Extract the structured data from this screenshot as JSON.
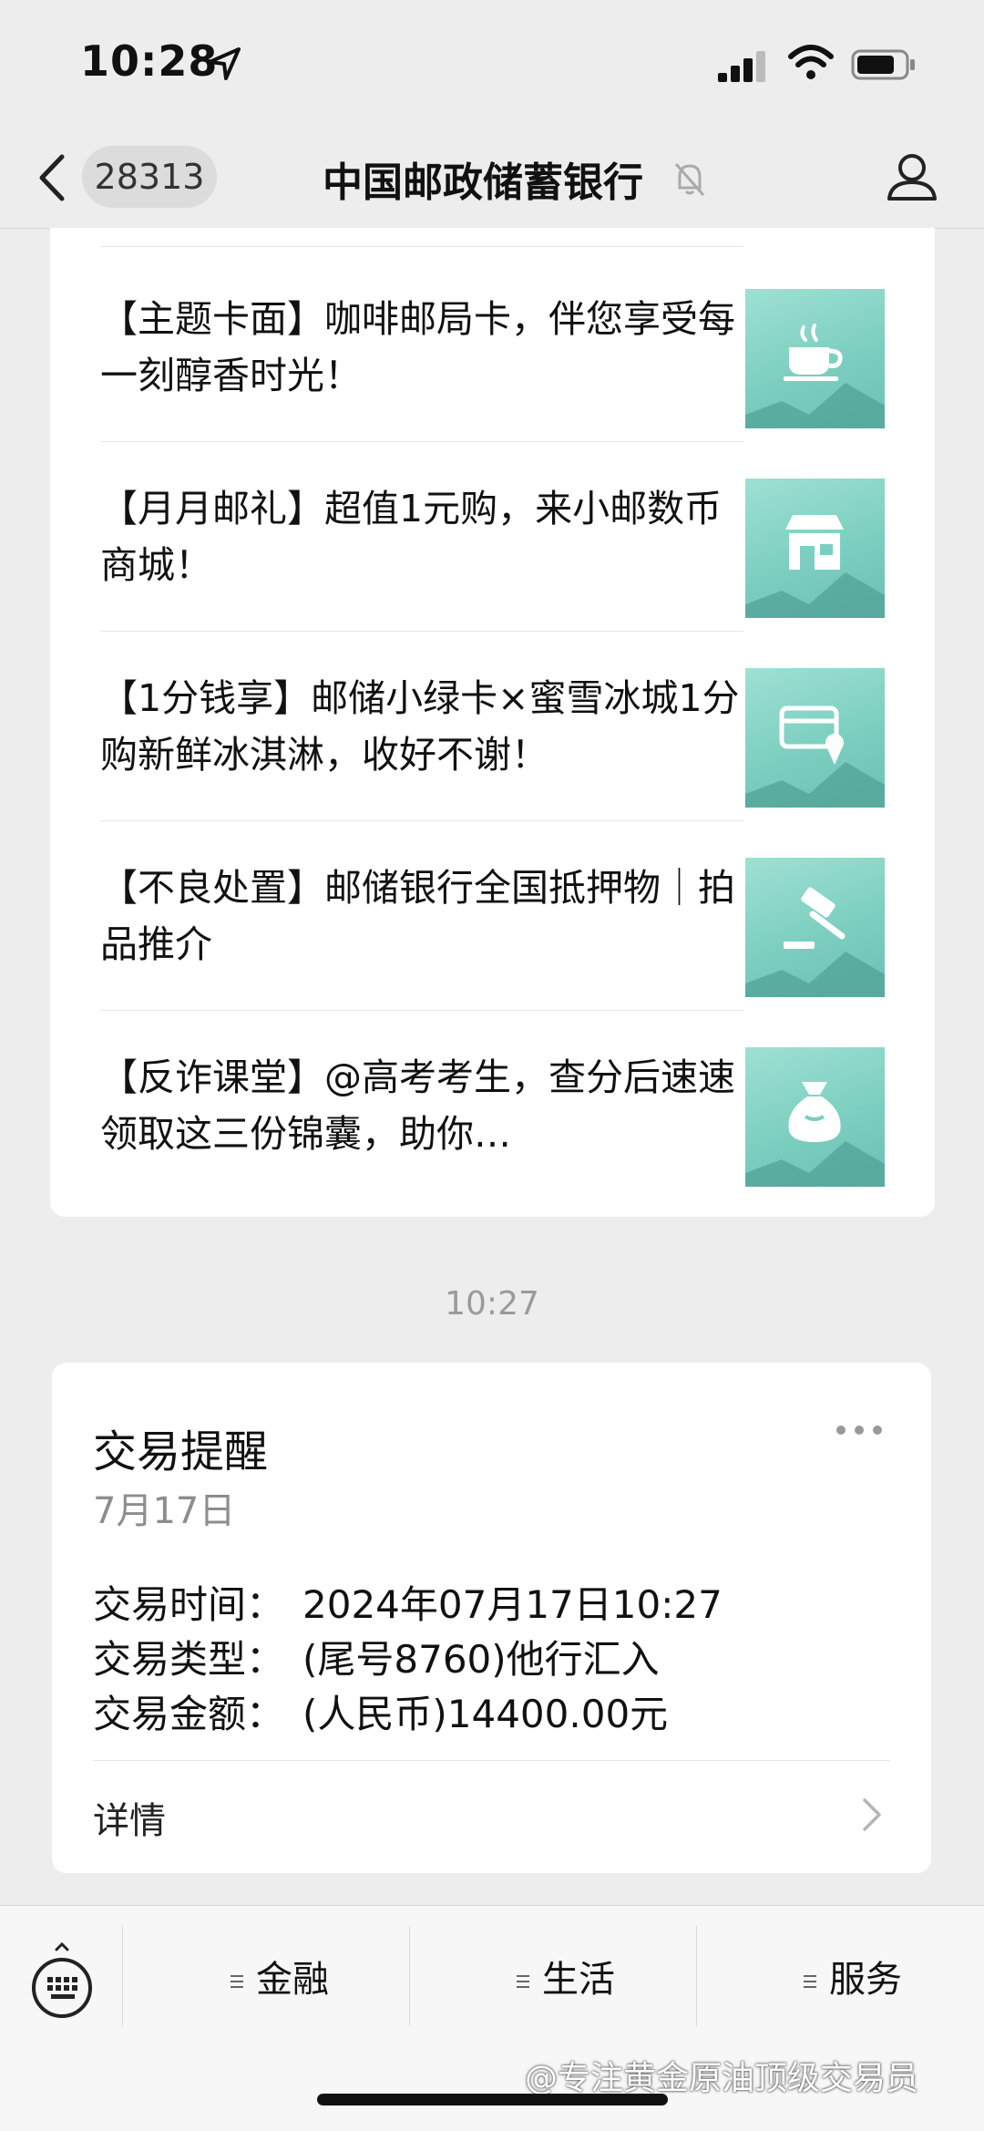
{
  "status_bar": {
    "time": "10:28"
  },
  "nav": {
    "unread_count": "28313",
    "title": "中国邮政储蓄银行"
  },
  "articles": [
    {
      "text": "【主题卡面】咖啡邮局卡，伴您享受每一刻醇香时光！",
      "icon": "coffee-cup-icon"
    },
    {
      "text": "【月月邮礼】超值1元购，来小邮数币商城！",
      "icon": "shop-icon"
    },
    {
      "text": "【1分钱享】邮储小绿卡×蜜雪冰城1分购新鲜冰淇淋，收好不谢！",
      "icon": "card-icecream-icon"
    },
    {
      "text": "【不良处置】邮储银行全国抵押物｜拍品推介",
      "icon": "auction-hammer-icon"
    },
    {
      "text": "【反诈课堂】@高考考生，查分后速速领取这三份锦囊，助你…",
      "icon": "money-bag-icon"
    }
  ],
  "time_separator": "10:27",
  "transaction": {
    "title": "交易提醒",
    "date": "7月17日",
    "rows": [
      {
        "label": "交易时间：",
        "value": "2024年07月17日10:27"
      },
      {
        "label": "交易类型：",
        "value": "(尾号8760)他行汇入"
      },
      {
        "label": "交易金额：",
        "value": "(人民币)14400.00元"
      }
    ],
    "details_label": "详情"
  },
  "bottom_menu": {
    "items": [
      "金融",
      "生活",
      "服务"
    ]
  },
  "watermark": "@专注黄金原油顶级交易员",
  "colors": {
    "thumb_bg": "#8fd8cb",
    "page_bg": "#ededed"
  }
}
